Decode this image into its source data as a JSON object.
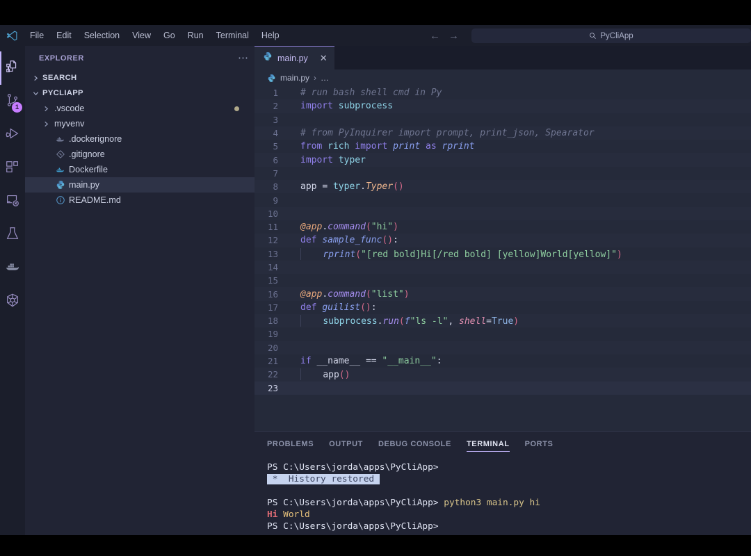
{
  "window": {
    "app_name": "Visual Studio Code",
    "logo_icon": "vscode-logo-icon"
  },
  "menu": {
    "items": [
      {
        "label": "File"
      },
      {
        "label": "Edit"
      },
      {
        "label": "Selection"
      },
      {
        "label": "View"
      },
      {
        "label": "Go"
      },
      {
        "label": "Run"
      },
      {
        "label": "Terminal"
      },
      {
        "label": "Help"
      }
    ]
  },
  "navigation": {
    "back_icon": "arrow-left-icon",
    "forward_icon": "arrow-right-icon"
  },
  "command_center": {
    "search_icon": "search-icon",
    "label": "PyCliApp"
  },
  "activity_bar": {
    "items": [
      {
        "name": "explorer",
        "icon": "files-icon",
        "active": true,
        "badge": ""
      },
      {
        "name": "source-control",
        "icon": "source-control-icon",
        "active": false,
        "badge": "1"
      },
      {
        "name": "run-and-debug",
        "icon": "run-debug-icon",
        "active": false,
        "badge": ""
      },
      {
        "name": "extensions",
        "icon": "extensions-icon",
        "active": false,
        "badge": ""
      },
      {
        "name": "remote-explorer",
        "icon": "remote-terminal-icon",
        "active": false,
        "badge": ""
      },
      {
        "name": "testing",
        "icon": "beaker-icon",
        "active": false,
        "badge": ""
      },
      {
        "name": "docker",
        "icon": "docker-whale-icon",
        "active": false,
        "badge": ""
      },
      {
        "name": "kubernetes",
        "icon": "kubernetes-helm-icon",
        "active": false,
        "badge": ""
      }
    ]
  },
  "sidebar": {
    "title": "EXPLORER",
    "more_actions_icon": "ellipsis-icon",
    "sections": [
      {
        "label": "SEARCH",
        "expanded": false,
        "chevron": "chevron-right-icon"
      },
      {
        "label": "PYCLIAPP",
        "expanded": true,
        "chevron": "chevron-down-icon"
      }
    ],
    "tree": [
      {
        "label": ".vscode",
        "type": "folder",
        "chevron": "chevron-right-icon",
        "icon": "folder-icon",
        "selected": false,
        "modified": true
      },
      {
        "label": "myvenv",
        "type": "folder",
        "chevron": "chevron-right-icon",
        "icon": "folder-icon",
        "selected": false,
        "modified": false
      },
      {
        "label": ".dockerignore",
        "type": "file",
        "chevron": "",
        "icon": "docker-icon",
        "selected": false,
        "modified": false
      },
      {
        "label": ".gitignore",
        "type": "file",
        "chevron": "",
        "icon": "git-icon",
        "selected": false,
        "modified": false
      },
      {
        "label": "Dockerfile",
        "type": "file",
        "chevron": "",
        "icon": "docker-icon",
        "selected": false,
        "modified": false
      },
      {
        "label": "main.py",
        "type": "file",
        "chevron": "",
        "icon": "python-icon",
        "selected": true,
        "modified": false
      },
      {
        "label": "README.md",
        "type": "file",
        "chevron": "",
        "icon": "info-icon",
        "selected": false,
        "modified": false
      }
    ]
  },
  "editor": {
    "tabs": [
      {
        "label": "main.py",
        "icon": "python-icon",
        "close_icon": "close-icon",
        "active": true
      }
    ],
    "breadcrumb": {
      "icon": "python-icon",
      "file": "main.py",
      "separator": "›",
      "ellipsis": "…"
    },
    "language": "python",
    "cursor_line": 23,
    "total_lines": 23,
    "lines": [
      {
        "n": 1,
        "text": "# run bash shell cmd in Py"
      },
      {
        "n": 2,
        "text": "import subprocess"
      },
      {
        "n": 3,
        "text": ""
      },
      {
        "n": 4,
        "text": "# from PyInquirer import prompt, print_json, Spearator"
      },
      {
        "n": 5,
        "text": "from rich import print as rprint"
      },
      {
        "n": 6,
        "text": "import typer"
      },
      {
        "n": 7,
        "text": ""
      },
      {
        "n": 8,
        "text": "app = typer.Typer()"
      },
      {
        "n": 9,
        "text": ""
      },
      {
        "n": 10,
        "text": ""
      },
      {
        "n": 11,
        "text": "@app.command(\"hi\")"
      },
      {
        "n": 12,
        "text": "def sample_func():"
      },
      {
        "n": 13,
        "text": "    rprint(\"[red bold]Hi[/red bold] [yellow]World[yellow]\")"
      },
      {
        "n": 14,
        "text": ""
      },
      {
        "n": 15,
        "text": ""
      },
      {
        "n": 16,
        "text": "@app.command(\"list\")"
      },
      {
        "n": 17,
        "text": "def guilist():"
      },
      {
        "n": 18,
        "text": "    subprocess.run(f\"ls -l\", shell=True)"
      },
      {
        "n": 19,
        "text": ""
      },
      {
        "n": 20,
        "text": ""
      },
      {
        "n": 21,
        "text": "if __name__ == \"__main__\":"
      },
      {
        "n": 22,
        "text": "    app()"
      },
      {
        "n": 23,
        "text": ""
      }
    ]
  },
  "panel": {
    "tabs": [
      {
        "label": "PROBLEMS",
        "active": false
      },
      {
        "label": "OUTPUT",
        "active": false
      },
      {
        "label": "DEBUG CONSOLE",
        "active": false
      },
      {
        "label": "TERMINAL",
        "active": true
      },
      {
        "label": "PORTS",
        "active": false
      }
    ],
    "terminal": {
      "prompt": "PS C:\\Users\\jorda\\apps\\PyCliApp>",
      "lines": [
        {
          "type": "prompt",
          "text": "PS C:\\Users\\jorda\\apps\\PyCliApp>"
        },
        {
          "type": "highlight",
          "marker": " * ",
          "text": " History restored "
        },
        {
          "type": "blank",
          "text": ""
        },
        {
          "type": "command",
          "prompt": "PS C:\\Users\\jorda\\apps\\PyCliApp>",
          "command": " python3 main.py hi"
        },
        {
          "type": "output",
          "red": "Hi",
          "yellow": " World"
        },
        {
          "type": "prompt",
          "text": "PS C:\\Users\\jorda\\apps\\PyCliApp>"
        }
      ]
    }
  },
  "colors": {
    "titlebar_bg": "#1b1e2b",
    "sidebar_bg": "#212434",
    "editor_bg": "#252a3a",
    "tabbar_bg": "#191c2a",
    "accent": "#c4b5fd",
    "selection_bg": "#2e3347",
    "badge_bg": "#c77dff",
    "letterbox": "#000000"
  }
}
